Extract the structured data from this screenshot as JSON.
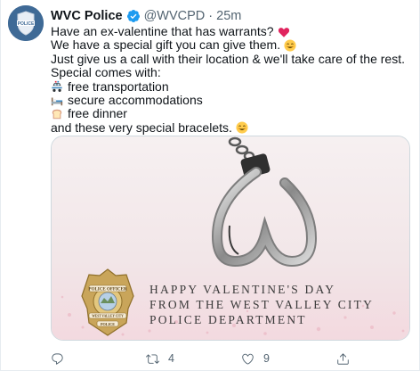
{
  "tweet": {
    "author_name": "WVC Police",
    "handle": "@WVCPD",
    "separator": "·",
    "time": "25m",
    "lines": [
      {
        "text": "Have an ex-valentine that has warrants?",
        "emoji": "red-heart"
      },
      {
        "text": "We have a special gift you can give them.",
        "emoji": "smiling-face"
      },
      {
        "text": "Just give us a call with their location & we'll take care of the rest.",
        "emoji": ""
      },
      {
        "text": "Special comes with:",
        "emoji": ""
      },
      {
        "text": "free transportation",
        "lead_emoji": "police-car"
      },
      {
        "text": "secure accommodations",
        "lead_emoji": "bed"
      },
      {
        "text": "free dinner",
        "lead_emoji": "bread"
      },
      {
        "text": "and these very special bracelets.",
        "emoji": "smiling-face"
      }
    ]
  },
  "card": {
    "caption_lines": [
      "HAPPY VALENTINE'S DAY",
      "FROM THE WEST VALLEY CITY",
      "POLICE DEPARTMENT"
    ],
    "badge_text": [
      "POLICE OFFICER",
      "WEST VALLEY CITY",
      "POLICE"
    ]
  },
  "actions": {
    "reply_count": "",
    "retweet_count": "4",
    "like_count": "9",
    "share_count": ""
  },
  "colors": {
    "accent": "#1d9bf0",
    "text_secondary": "#536471",
    "card_pink": "#f3eaec",
    "heart_red": "#e0245e"
  },
  "icons": [
    "reply-icon",
    "retweet-icon",
    "like-icon",
    "share-icon",
    "verified-icon"
  ]
}
